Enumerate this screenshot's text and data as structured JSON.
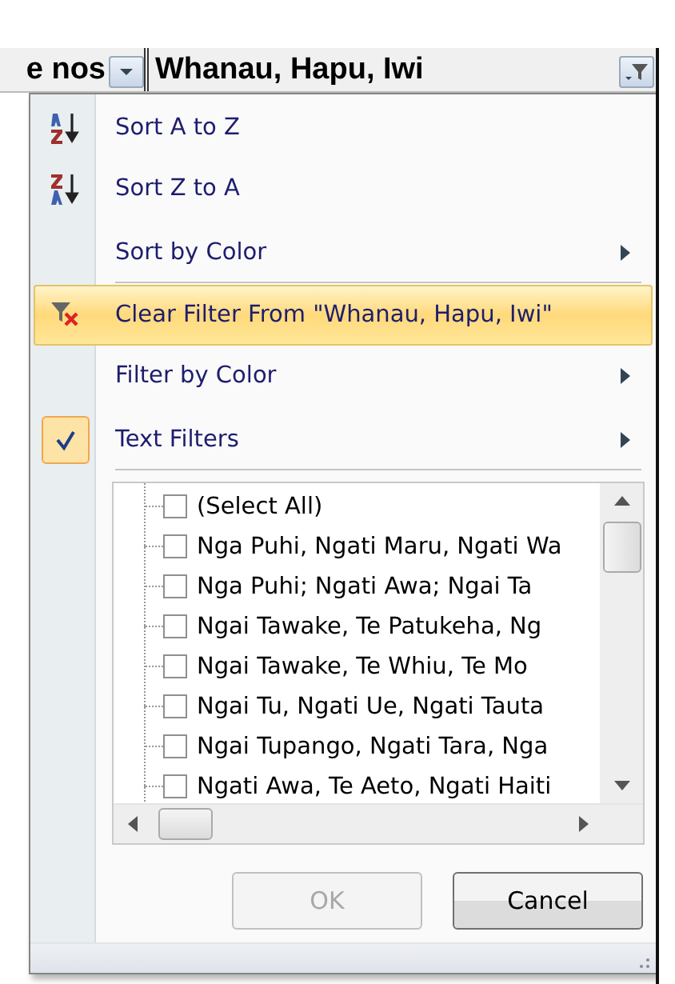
{
  "column_headers": [
    {
      "label": "e nos",
      "filter_active": false
    },
    {
      "label": "Whanau, Hapu, Iwi",
      "filter_active": true
    }
  ],
  "menu": {
    "items": [
      {
        "kind": "sort_ascending",
        "label": "Sort A to Z",
        "highlighted": false,
        "checked": false,
        "submenu": false,
        "separator_after": false
      },
      {
        "kind": "sort_descending",
        "label": "Sort Z to A",
        "highlighted": false,
        "checked": false,
        "submenu": false,
        "separator_after": false
      },
      {
        "kind": "plain",
        "label": "Sort by Color",
        "highlighted": false,
        "checked": false,
        "submenu": true,
        "separator_after": true
      },
      {
        "kind": "clear_filter",
        "label": "Clear Filter From \"Whanau, Hapu, Iwi\"",
        "highlighted": true,
        "checked": false,
        "submenu": false,
        "separator_after": false
      },
      {
        "kind": "plain",
        "label": "Filter by Color",
        "highlighted": false,
        "checked": false,
        "submenu": true,
        "separator_after": false
      },
      {
        "kind": "plain",
        "label": "Text Filters",
        "highlighted": false,
        "checked": true,
        "submenu": true,
        "separator_after": true
      }
    ]
  },
  "filter_list": {
    "items": [
      {
        "label": "(Select All)",
        "checked": false
      },
      {
        "label": "Nga Puhi, Ngati Maru, Ngati Wa",
        "checked": false
      },
      {
        "label": "Nga Puhi; Ngati Awa; Ngai Ta",
        "checked": false
      },
      {
        "label": "Ngai Tawake, Te Patukeha, Ng",
        "checked": false
      },
      {
        "label": "Ngai Tawake, Te Whiu, Te Mo",
        "checked": false
      },
      {
        "label": "Ngai Tu, Ngati Ue, Ngati Tauta",
        "checked": false
      },
      {
        "label": "Ngai Tupango, Ngati Tara, Nga",
        "checked": false
      },
      {
        "label": "Ngati Awa, Te Aeto, Ngati Haiti",
        "checked": false
      }
    ]
  },
  "buttons": [
    {
      "label": "OK",
      "disabled": true
    },
    {
      "label": "Cancel",
      "disabled": false
    }
  ]
}
